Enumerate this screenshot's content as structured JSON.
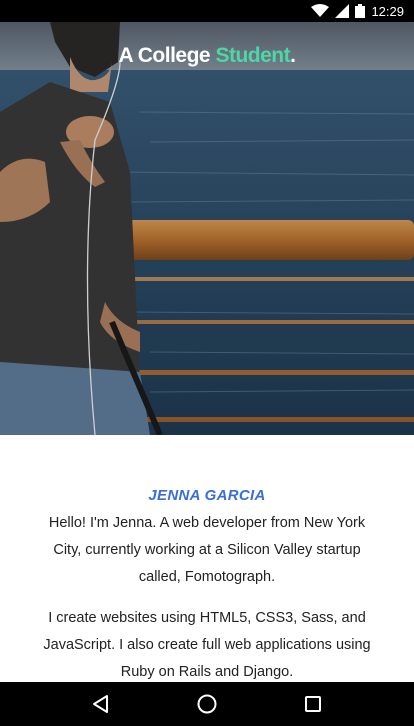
{
  "status_bar": {
    "time": "12:29"
  },
  "hero": {
    "title_prefix": "A College ",
    "title_accent": "Student",
    "title_suffix": "."
  },
  "bio": {
    "name": "JENNA GARCIA",
    "paragraph_1": "Hello! I'm Jenna. A web developer from New York City, currently working at a Silicon Valley startup called, Fomotograph.",
    "paragraph_2": "I create websites using HTML5, CSS3, Sass, and JavaScript. I also create full web applications using Ruby on Rails and Django."
  },
  "colors": {
    "accent": "#4ed6a4",
    "name": "#3a6ed6"
  },
  "icons": {
    "status": [
      "wifi-icon",
      "signal-icon",
      "battery-icon"
    ],
    "nav": [
      "back-icon",
      "home-icon",
      "recents-icon"
    ]
  }
}
